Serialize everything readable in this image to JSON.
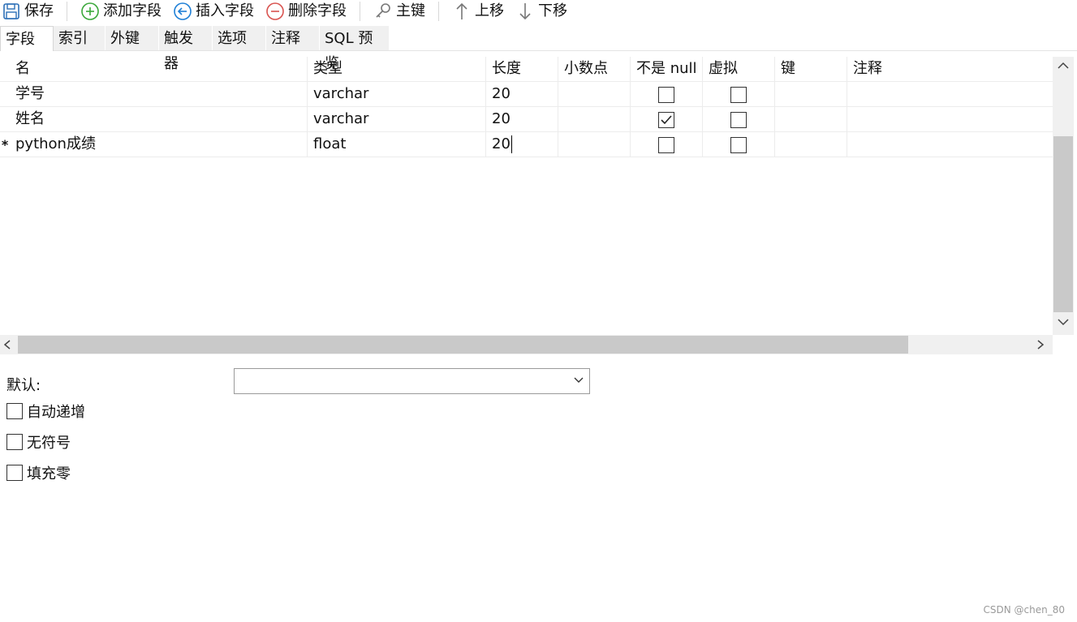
{
  "toolbar": {
    "save": "保存",
    "add_field": "添加字段",
    "insert_field": "插入字段",
    "delete_field": "删除字段",
    "primary_key": "主键",
    "move_up": "上移",
    "move_down": "下移"
  },
  "tabs": [
    "字段",
    "索引",
    "外键",
    "触发器",
    "选项",
    "注释",
    "SQL 预览"
  ],
  "columns": [
    "名",
    "类型",
    "长度",
    "小数点",
    "不是 null",
    "虚拟",
    "键",
    "注释"
  ],
  "rows": [
    {
      "name": "学号",
      "type": "varchar",
      "length": "20",
      "decimals": "",
      "not_null": false,
      "virtual": false,
      "key": "",
      "comment": "",
      "marker": ""
    },
    {
      "name": "姓名",
      "type": "varchar",
      "length": "20",
      "decimals": "",
      "not_null": true,
      "virtual": false,
      "key": "",
      "comment": "",
      "marker": ""
    },
    {
      "name": "python成绩",
      "type": "float",
      "length": "20",
      "decimals": "",
      "not_null": false,
      "virtual": false,
      "key": "",
      "comment": "",
      "marker": "*"
    }
  ],
  "properties": {
    "default_label": "默认:",
    "default_value": "",
    "auto_increment": "自动递增",
    "unsigned": "无符号",
    "zerofill": "填充零"
  },
  "watermark": "CSDN @chen_80",
  "colors": {
    "add": "#3aa83a",
    "insert": "#1e7fd6",
    "delete": "#d9534f"
  }
}
